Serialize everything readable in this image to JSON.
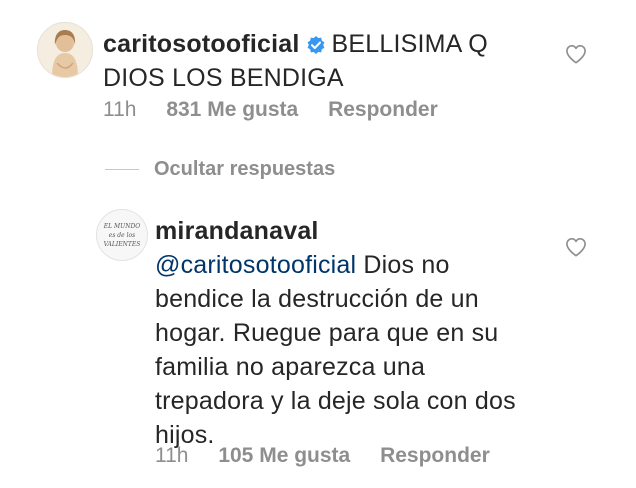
{
  "comments": [
    {
      "username": "caritosotooficial",
      "verified": true,
      "text_line1": "BELLISIMA Q",
      "text_line2": "DIOS LOS BENDIGA",
      "time": "11h",
      "likes": "831 Me gusta",
      "reply": "Responder"
    }
  ],
  "replies_toggle": {
    "label": "Ocultar respuestas"
  },
  "reply": {
    "username": "mirandanaval",
    "avatar_text_line1": "EL MUNDO",
    "avatar_text_line2": "es de los",
    "avatar_text_line3": "VALIENTES",
    "mention": "@caritosotooficial",
    "text_line1_rest": " Dios no",
    "text_line2": "bendice la destrucción de un",
    "text_line3": "hogar. Ruegue para que en su",
    "text_line4": "familia no aparezca una",
    "text_line5": "trepadora y la deje sola con dos",
    "text_line6": "hijos.",
    "time": "11h",
    "likes": "105 Me gusta",
    "reply": "Responder"
  },
  "colors": {
    "text": "#262626",
    "muted": "#8e8e8e",
    "mention": "#003569",
    "verified_badge": "#3897f0"
  }
}
